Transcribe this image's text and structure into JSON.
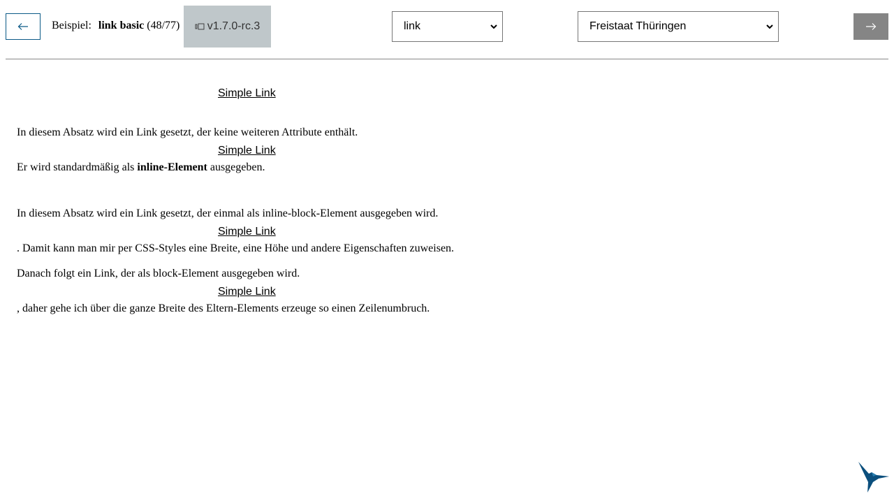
{
  "toolbar": {
    "example_prefix": "Beispiel:",
    "example_name": "link basic",
    "example_count": "(48/77)",
    "version": "v1.7.0-rc.3",
    "component_select": "link",
    "theme_select": "Freistaat Thüringen",
    "prev_icon": "arrow-left-icon",
    "next_icon": "arrow-right-icon",
    "version_icon": "flip-icon"
  },
  "content": {
    "link_label": "Simple Link",
    "p1_before": "In diesem Absatz wird ein Link gesetzt, der keine weiteren Attribute enthält.",
    "p1_after_prefix": "Er wird standardmäßig als ",
    "p1_after_bold": "inline-Element",
    "p1_after_suffix": " ausgegeben.",
    "p2_before": "In diesem Absatz wird ein Link gesetzt, der einmal als inline-block-Element ausgegeben wird.",
    "p2_after": ". Damit kann man mir per CSS-Styles eine Breite, eine Höhe und andere Eigenschaften zuweisen.",
    "p3_before": "Danach folgt ein Link, der als block-Element ausgegeben wird.",
    "p3_after": ", daher gehe ich über die ganze Breite des Eltern-Elements erzeuge so einen Zeilenumbruch."
  },
  "colors": {
    "accent": "#0b5a87",
    "next_button": "#858585",
    "version_bg": "#bfc7ca"
  },
  "branding": {
    "logo_icon": "hummingbird-logo"
  }
}
